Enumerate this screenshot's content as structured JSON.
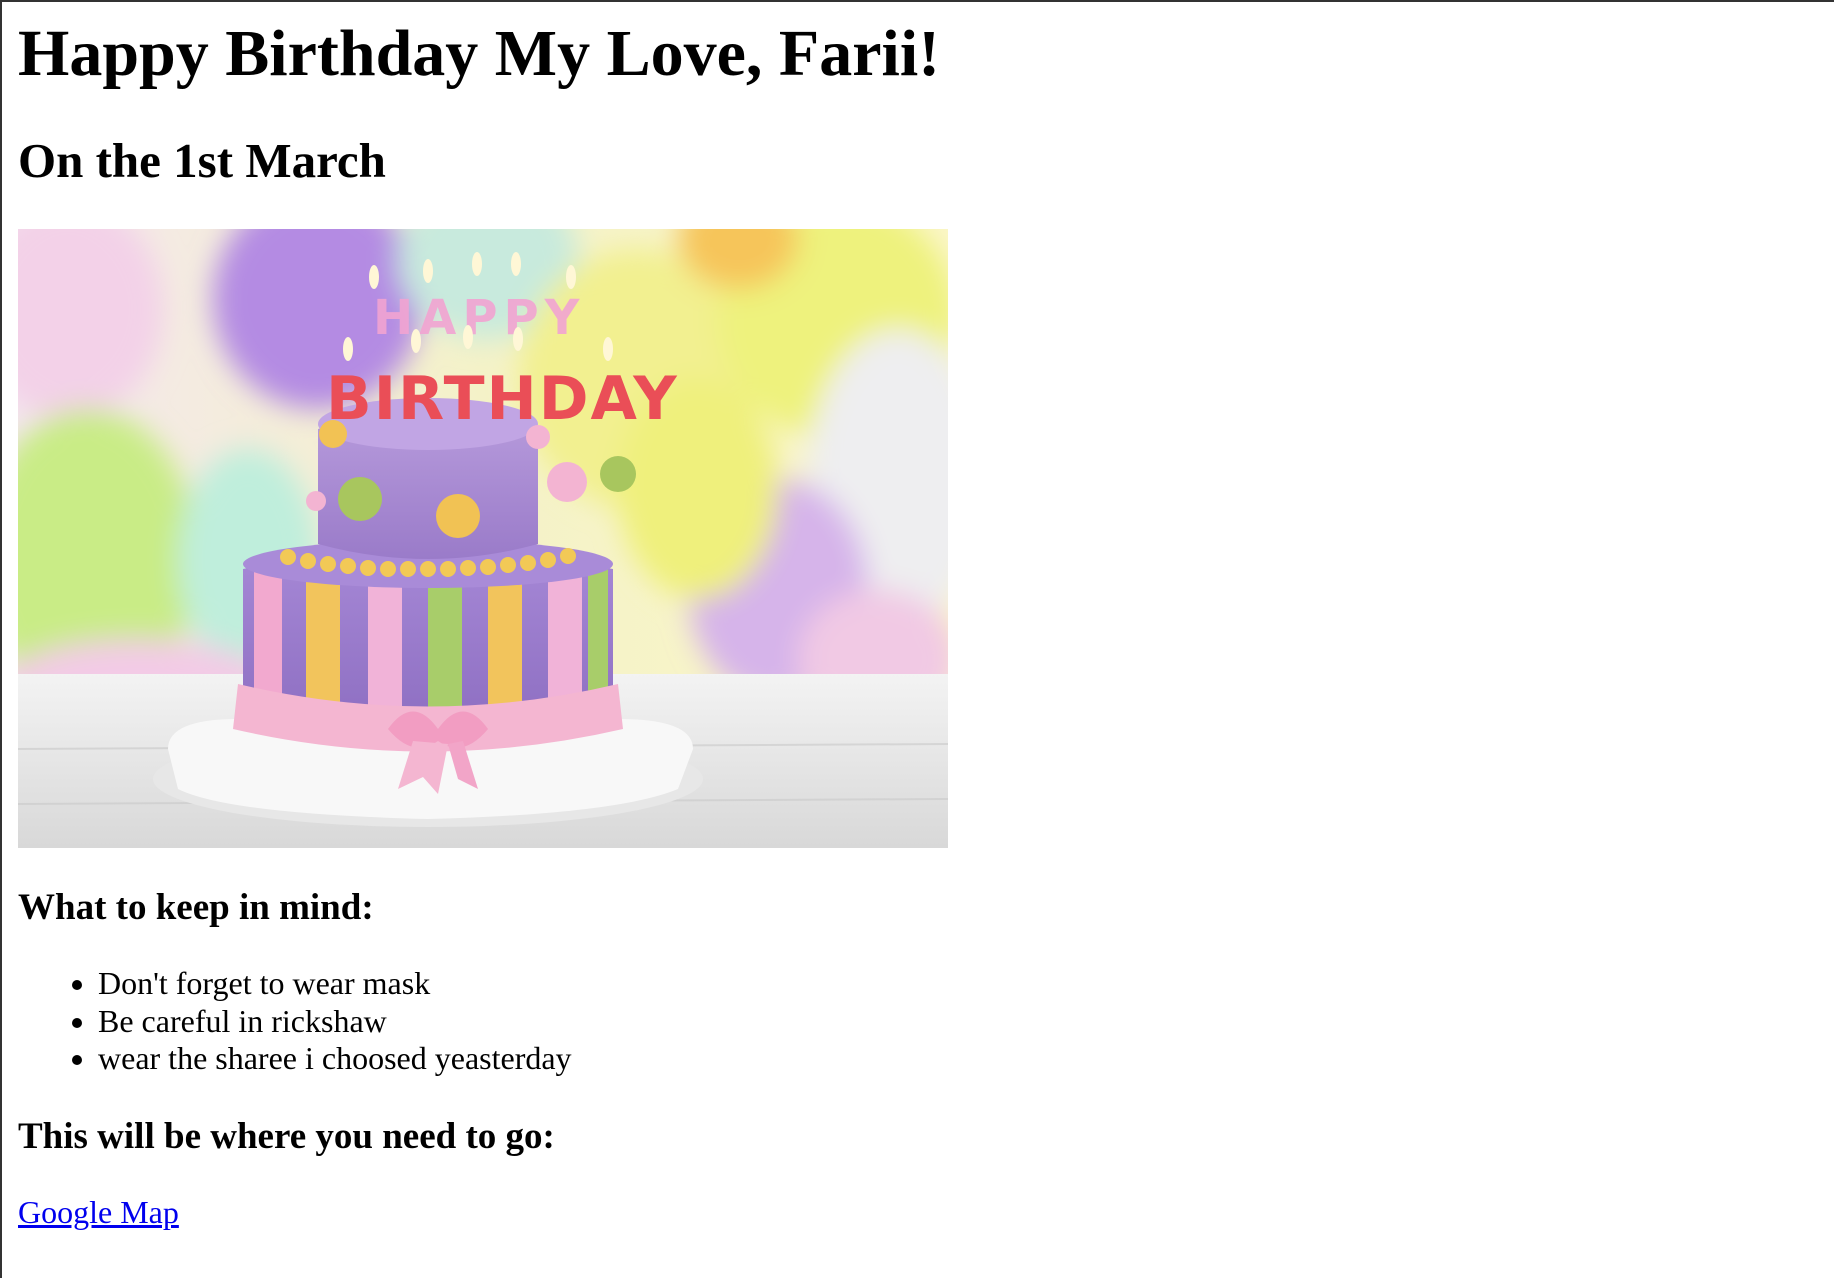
{
  "page": {
    "title": "Happy Birthday My Love, Farii!",
    "subtitle": "On the 1st March"
  },
  "image": {
    "cake_letters_top": "HAPPY",
    "cake_letters_bottom": "BIRTHDAY"
  },
  "keep_in_mind": {
    "heading": "What to keep in mind:",
    "items": [
      "Don't forget to wear mask",
      "Be careful in rickshaw",
      "wear the sharee i choosed yeasterday"
    ]
  },
  "directions": {
    "heading": "This will be where you need to go:",
    "link_label": "Google Map"
  },
  "colors": {
    "link": "#0000ee",
    "text": "#000000",
    "background": "#ffffff"
  }
}
